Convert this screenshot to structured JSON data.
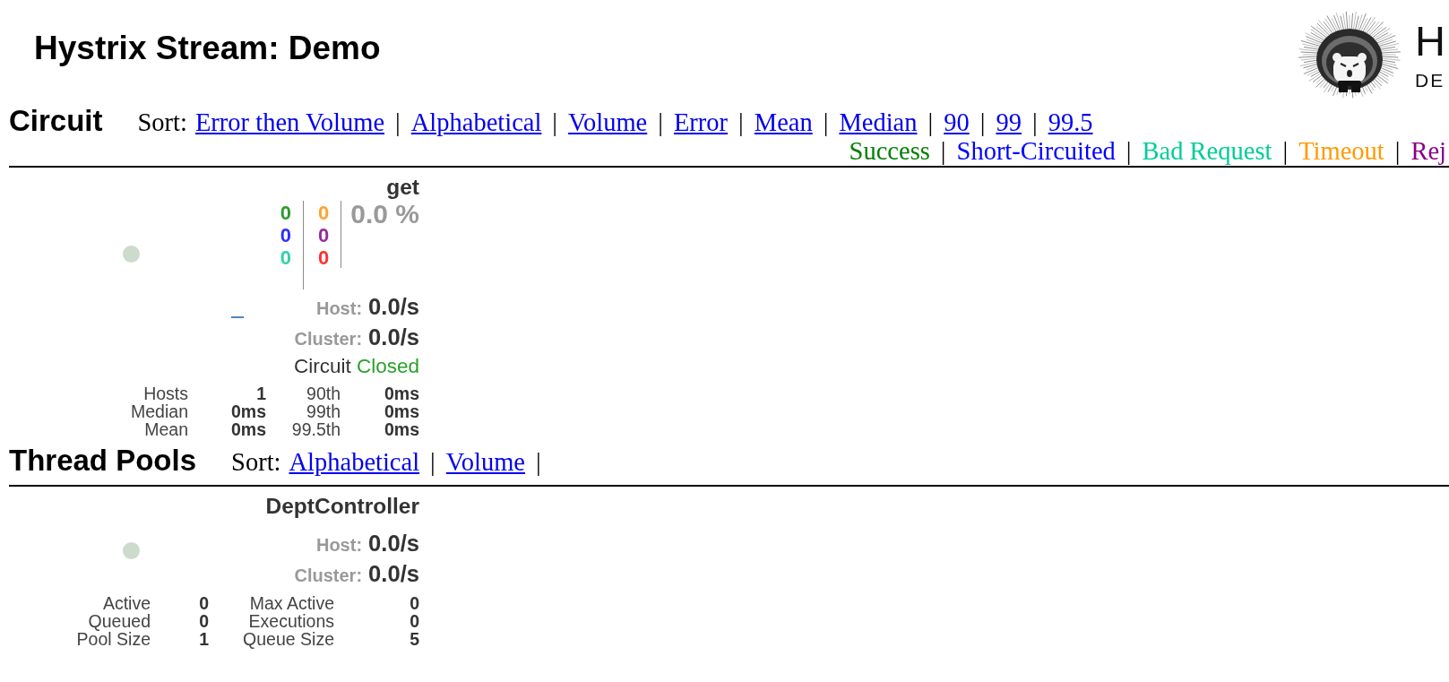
{
  "header": {
    "title": "Hystrix Stream: Demo",
    "logo": {
      "title": "H",
      "subtitle": "DE"
    }
  },
  "circuit_section": {
    "heading": "Circuit",
    "sort": {
      "label": "Sort:",
      "items": [
        {
          "kind": "link",
          "text": "Error then Volume"
        },
        {
          "kind": "separator",
          "text": "|"
        },
        {
          "kind": "link",
          "text": "Alphabetical"
        },
        {
          "kind": "separator",
          "text": "|"
        },
        {
          "kind": "link",
          "text": "Volume"
        },
        {
          "kind": "separator",
          "text": "|"
        },
        {
          "kind": "link",
          "text": "Error"
        },
        {
          "kind": "separator",
          "text": "|"
        },
        {
          "kind": "link",
          "text": "Mean"
        },
        {
          "kind": "separator",
          "text": "|"
        },
        {
          "kind": "link",
          "text": "Median"
        },
        {
          "kind": "separator",
          "text": "|"
        },
        {
          "kind": "link",
          "text": "90"
        },
        {
          "kind": "separator",
          "text": "|"
        },
        {
          "kind": "link",
          "text": "99"
        },
        {
          "kind": "separator",
          "text": "|"
        },
        {
          "kind": "link",
          "text": "99.5"
        }
      ]
    },
    "legend": [
      {
        "kind": "label",
        "text": "Success",
        "color": "#008000"
      },
      {
        "kind": "separator",
        "text": "|"
      },
      {
        "kind": "label",
        "text": "Short-Circuited",
        "color": "#0000ff"
      },
      {
        "kind": "separator",
        "text": "|"
      },
      {
        "kind": "label",
        "text": "Bad Request",
        "color": "#00cc99"
      },
      {
        "kind": "separator",
        "text": "|"
      },
      {
        "kind": "label",
        "text": "Timeout",
        "color": "#ff9900"
      },
      {
        "kind": "separator",
        "text": "|"
      },
      {
        "kind": "label",
        "text": "Rej",
        "color": "#880088"
      }
    ],
    "circuits": [
      {
        "name": "get",
        "count_columns": [
          {
            "counts": [
              {
                "value": "0",
                "color": "#2c9c2c"
              },
              {
                "value": "0",
                "color": "#2f2fff"
              },
              {
                "value": "0",
                "color": "#33d1a8"
              }
            ]
          },
          {
            "counts": [
              {
                "value": "0",
                "color": "#ffa230"
              },
              {
                "value": "0",
                "color": "#952f95"
              },
              {
                "value": "0",
                "color": "#ff3030"
              }
            ]
          }
        ],
        "error_rate": "0.0 %",
        "rates": [
          {
            "label": "Host:",
            "value": "0.0/s"
          },
          {
            "label": "Cluster:",
            "value": "0.0/s"
          }
        ],
        "status": {
          "label": "Circuit",
          "value": "Closed",
          "open": false
        },
        "stats": [
          {
            "label": "Hosts",
            "value": "1",
            "label_2": "90th",
            "value_2": "0ms"
          },
          {
            "label": "Median",
            "value": "0ms",
            "label_2": "99th",
            "value_2": "0ms"
          },
          {
            "label": "Mean",
            "value": "0ms",
            "label_2": "99.5th",
            "value_2": "0ms"
          }
        ]
      }
    ]
  },
  "thread_pool_section": {
    "heading": "Thread Pools",
    "sort": {
      "label": "Sort:",
      "items": [
        {
          "kind": "link",
          "text": "Alphabetical"
        },
        {
          "kind": "separator",
          "text": "|"
        },
        {
          "kind": "link",
          "text": "Volume"
        },
        {
          "kind": "separator",
          "text": "|"
        }
      ]
    },
    "pools": [
      {
        "name": "DeptController",
        "rates": [
          {
            "label": "Host:",
            "value": "0.0/s"
          },
          {
            "label": "Cluster:",
            "value": "0.0/s"
          }
        ],
        "stats": [
          {
            "label": "Active",
            "value": "0",
            "label_2": "Max Active",
            "value_2": "0"
          },
          {
            "label": "Queued",
            "value": "0",
            "label_2": "Executions",
            "value_2": "0"
          },
          {
            "label": "Pool Size",
            "value": "1",
            "label_2": "Queue Size",
            "value_2": "5"
          }
        ]
      }
    ]
  }
}
